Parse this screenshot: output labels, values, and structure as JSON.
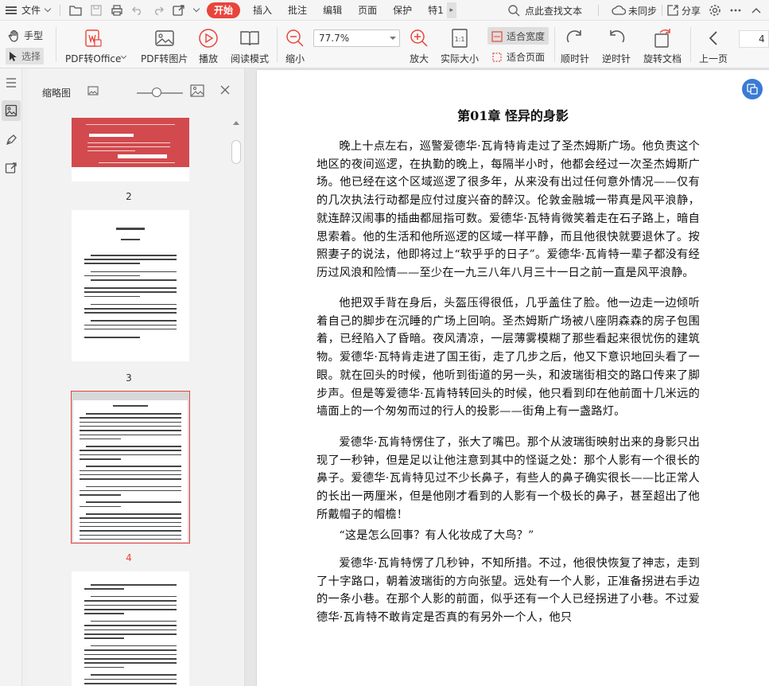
{
  "menubar": {
    "file_label": "文件",
    "tabs": [
      {
        "label": "开始",
        "active": true
      },
      {
        "label": "插入"
      },
      {
        "label": "批注"
      },
      {
        "label": "编辑"
      },
      {
        "label": "页面"
      },
      {
        "label": "保护"
      },
      {
        "label": "特1"
      }
    ],
    "search_label": "点此查找文本",
    "sync_label": "未同步",
    "share_label": "分享",
    "accent": "#e8453c"
  },
  "toolbar": {
    "hand_label": "手型",
    "select_label": "选择",
    "pdf_office_label": "PDF转Office",
    "pdf_image_label": "PDF转图片",
    "play_label": "播放",
    "read_mode_label": "阅读模式",
    "zoom_out_label": "缩小",
    "zoom_value": "77.7%",
    "zoom_in_label": "放大",
    "actual_size_label": "实际大小",
    "fit_width_label": "适合宽度",
    "fit_page_label": "适合页面",
    "rotate_cw_label": "顺时针",
    "rotate_ccw_label": "逆时针",
    "rotate_doc_label": "旋转文档",
    "prev_page_label": "上一页",
    "page_number": "4"
  },
  "thumbpanel": {
    "title": "缩略图",
    "pages": [
      {
        "label": "2"
      },
      {
        "label": "3"
      },
      {
        "label": "4",
        "selected": true
      }
    ]
  },
  "document": {
    "chapter_title": "第01章 怪异的身影",
    "paragraphs": [
      "晚上十点左右，巡警爱德华·瓦肯特肯走过了圣杰姆斯广场。他负责这个地区的夜间巡逻，在执勤的晚上，每隔半小时，他都会经过一次圣杰姆斯广场。他已经在这个区域巡逻了很多年，从来没有出过任何意外情况——仅有的几次执法行动都是应付过度兴奋的醉汉。伦敦金融城一带真是风平浪静，就连醉汉闹事的插曲都屈指可数。爱德华·瓦特肯微笑着走在石子路上，暗自思索着。他的生活和他所巡逻的区域一样平静，而且他很快就要退休了。按照妻子的说法，他即将过上“软乎乎的日子”。爱德华·瓦肯特一辈子都没有经历过风浪和险情——至少在一九三八年八月三十一日之前一直是风平浪静。",
      "他把双手背在身后，头盔压得很低，几乎盖住了脸。他一边走一边倾听着自己的脚步在沉睡的广场上回响。圣杰姆斯广场被八座阴森森的房子包围着，已经陷入了昏暗。夜风清凉，一层薄雾模糊了那些看起来很忧伤的建筑物。爱德华·瓦特肯走进了国王街，走了几步之后，他又下意识地回头看了一眼。就在回头的时候，他听到街道的另一头，和波瑞街相交的路口传来了脚步声。但是等爱德华·瓦肯特转回头的时候，他只看到印在他前面十几米远的墙面上的一个匆匆而过的行人的投影——街角上有一盏路灯。",
      "爱德华·瓦肯特愣住了，张大了嘴巴。那个从波瑞街映射出来的身影只出现了一秒钟，但是足以让他注意到其中的怪诞之处：那个人影有一个很长的鼻子。爱德华·瓦肯特见过不少长鼻子，有些人的鼻子确实很长——比正常人的长出一两厘米，但是他刚才看到的人影有一个极长的鼻子，甚至超出了他所戴帽子的帽檐！",
      "“这是怎么回事？有人化妆成了大鸟？”",
      "爱德华·瓦肯特愣了几秒钟，不知所措。不过，他很快恢复了神志，走到了十字路口，朝着波瑞街的方向张望。远处有一个人影，正准备拐进右手边的一条小巷。在那个人影的前面，似乎还有一个人已经拐进了小巷。不过爱德华·瓦肯特不敢肯定是否真的有另外一个人，他只"
    ]
  }
}
